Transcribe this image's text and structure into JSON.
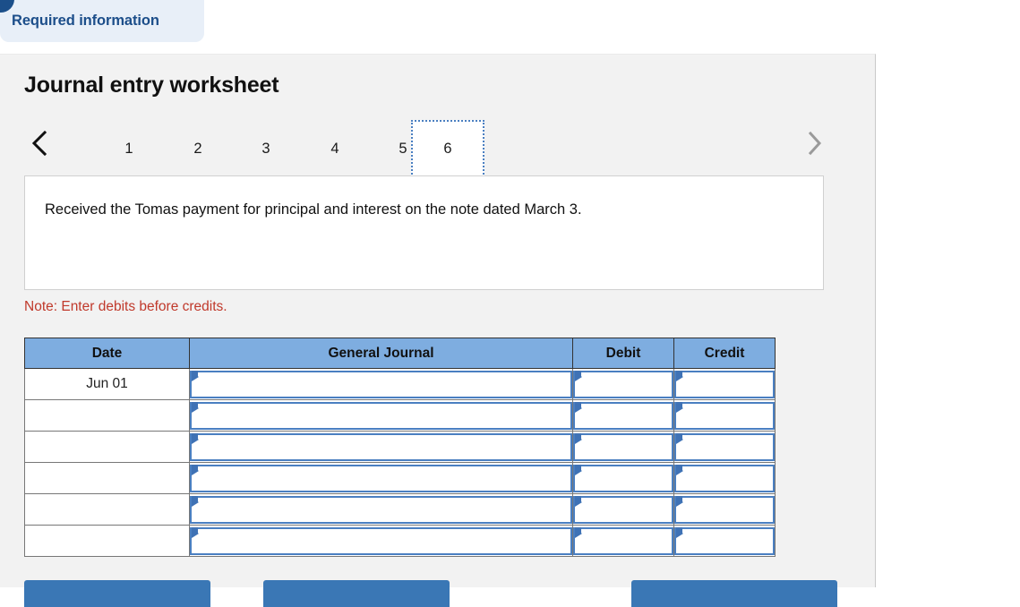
{
  "top_tab": {
    "label": "Required information"
  },
  "worksheet": {
    "title": "Journal entry worksheet",
    "pager": {
      "prev_icon": "chevron-left-icon",
      "next_icon": "chevron-right-icon",
      "tabs": [
        "1",
        "2",
        "3",
        "4",
        "5",
        "6"
      ],
      "active": "6"
    },
    "transaction": {
      "text": "Received the Tomas payment for principal and interest on the note dated March 3."
    },
    "note": "Note: Enter debits before credits.",
    "table": {
      "headers": [
        "Date",
        "General Journal",
        "Debit",
        "Credit"
      ],
      "rows": [
        {
          "date": "Jun 01",
          "general_journal": "",
          "debit": "",
          "credit": ""
        },
        {
          "date": "",
          "general_journal": "",
          "debit": "",
          "credit": ""
        },
        {
          "date": "",
          "general_journal": "",
          "debit": "",
          "credit": ""
        },
        {
          "date": "",
          "general_journal": "",
          "debit": "",
          "credit": ""
        },
        {
          "date": "",
          "general_journal": "",
          "debit": "",
          "credit": ""
        },
        {
          "date": "",
          "general_journal": "",
          "debit": "",
          "credit": ""
        }
      ]
    },
    "buttons": {
      "record": "",
      "clear": "",
      "journal": ""
    }
  },
  "colors": {
    "header_blue": "#7eade0",
    "field_border": "#4a7fc1",
    "button_blue": "#3a77b5",
    "note_red": "#c0392b",
    "tab_text_blue": "#1c4e8a",
    "panel_grey": "#f2f2f2"
  }
}
